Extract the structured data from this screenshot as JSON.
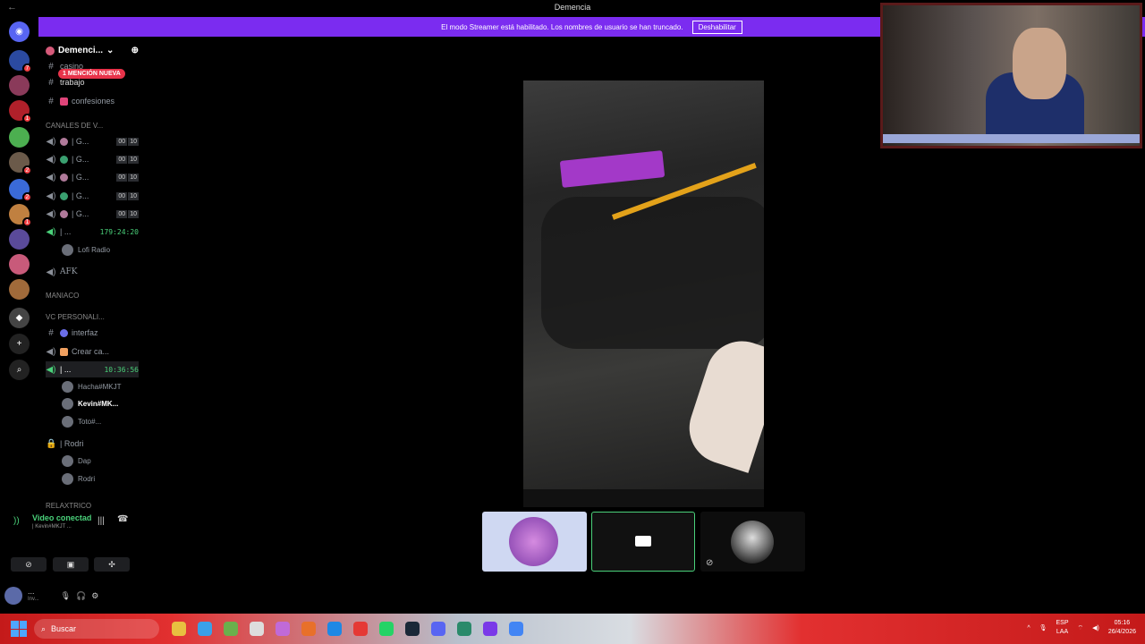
{
  "window": {
    "title": "Demencia",
    "back_glyph": "←"
  },
  "banner": {
    "text": "El modo Streamer está habilitado. Los nombres de usuario se han truncado.",
    "button": "Deshabilitar"
  },
  "servers": [
    {
      "color": "#5865f2",
      "glyph": "◉"
    },
    {
      "color": "#2b4aa0",
      "badge": "7"
    },
    {
      "color": "#8a3a5a"
    },
    {
      "color": "#b0202a",
      "badge": "1"
    },
    {
      "color": "#4caf50"
    },
    {
      "color": "#6b5a4a",
      "badge": "2"
    },
    {
      "color": "#3a6ad8",
      "badge": "2"
    },
    {
      "color": "#c08040",
      "badge": "1"
    },
    {
      "color": "#5a4a9a"
    },
    {
      "color": "#c85a7a"
    },
    {
      "color": "#a06a3a"
    },
    {
      "color": "#444",
      "glyph": "◆"
    },
    {
      "color": "#222",
      "glyph": "+"
    },
    {
      "color": "#222",
      "glyph": "⌕"
    }
  ],
  "guild": {
    "name": "Demenci...",
    "mention_pill": "1 MENCIÓN NUEVA"
  },
  "channels": {
    "casino": "casino",
    "trabajo": "trabajo",
    "confesiones": "confesiones",
    "cat_voice": "CANALES DE V...",
    "voice_rooms": [
      {
        "name": "| G...",
        "a": "00",
        "b": "10"
      },
      {
        "name": "| G...",
        "a": "00",
        "b": "10"
      },
      {
        "name": "| G...",
        "a": "00",
        "b": "10"
      },
      {
        "name": "| G...",
        "a": "00",
        "b": "10"
      },
      {
        "name": "| G...",
        "a": "00",
        "b": "10"
      }
    ],
    "music_room": "| ...",
    "music_time": "179:24:20",
    "lofi": "Lofi Radio",
    "afk": "AFK",
    "cat_maniaco": "MANIACO",
    "cat_vc": "VC PERSONALI...",
    "interfaz": "interfaz",
    "crear": "Crear ca...",
    "active_room": "| ...",
    "active_time": "10:36:56",
    "members": [
      "Hacha#MKJT",
      "Kevin#MK...",
      "Toto#..."
    ],
    "rodri_room": "| Rodri",
    "rodri_members": [
      "Dap",
      "Rodri"
    ],
    "bottom_cat": "relaxtrico"
  },
  "voice": {
    "status": "Video conectad",
    "sub": "| Kevin#MKJT ..."
  },
  "userbar": {
    "name": "...",
    "status": "Inv..."
  },
  "taskbar": {
    "search": "Buscar",
    "lang1": "ESP",
    "lang2": "LAA",
    "time": "05:16",
    "date": "26/4/2026"
  }
}
